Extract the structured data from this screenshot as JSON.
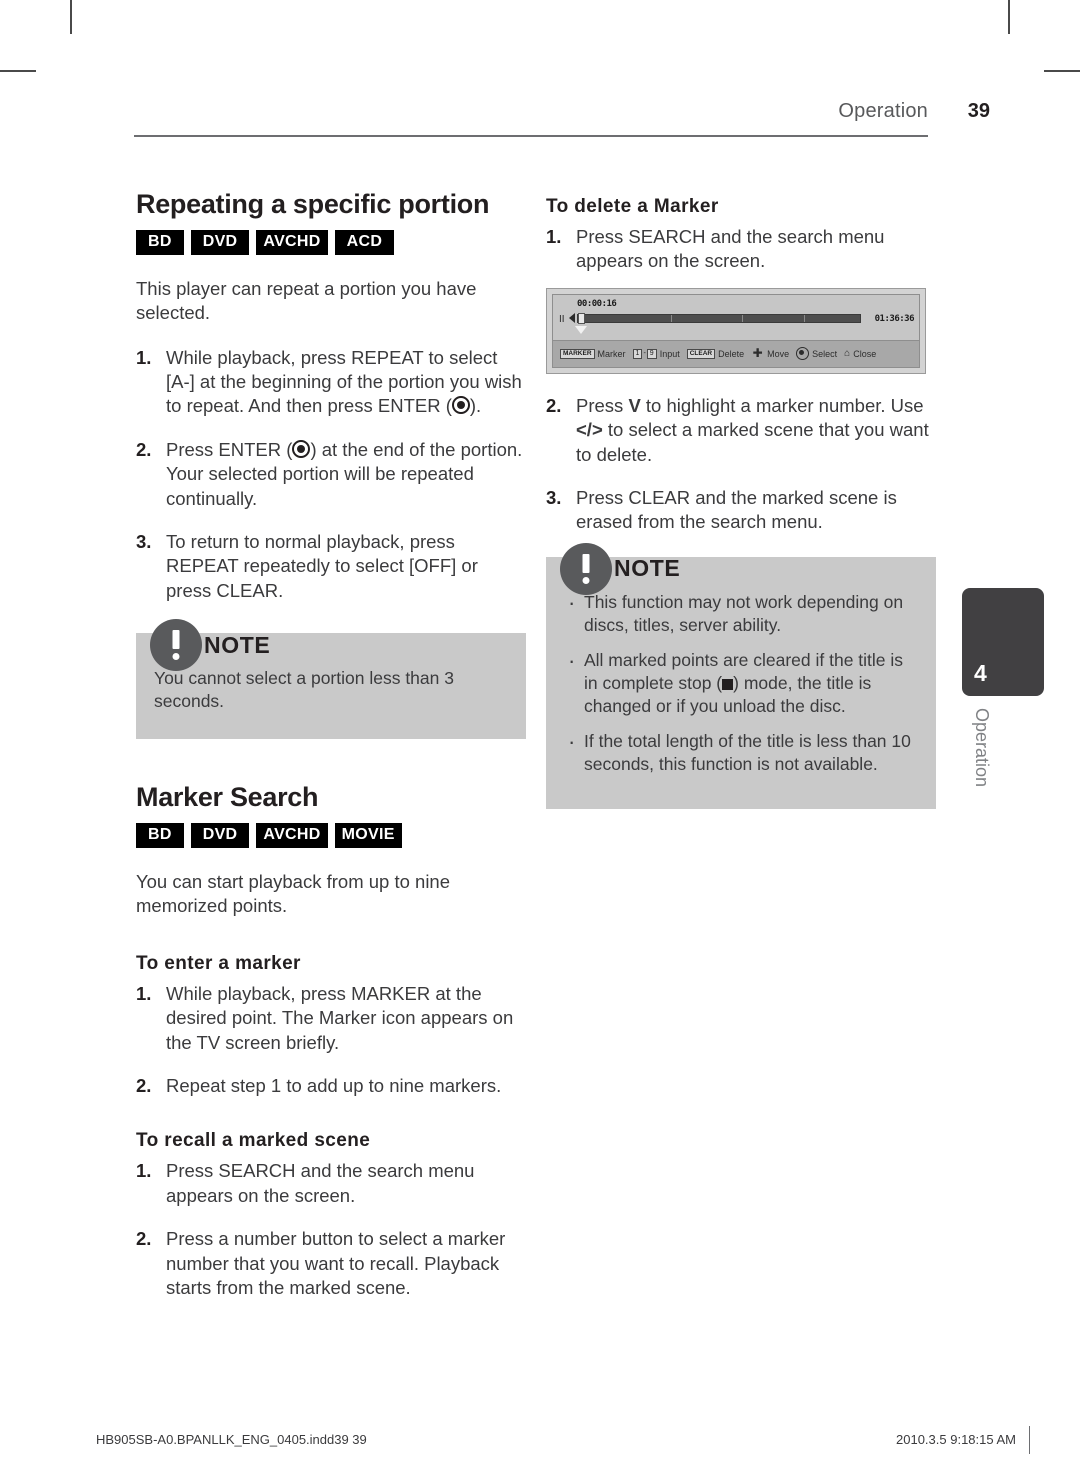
{
  "header": {
    "title": "Operation",
    "page_number": "39"
  },
  "left_column": {
    "section_title": "Repeating a specific portion",
    "badges": [
      "BD",
      "DVD",
      "AVCHD",
      "ACD"
    ],
    "intro": "This player can repeat a portion you have selected.",
    "steps": [
      {
        "num": "1.",
        "parts": [
          "While playback, press REPEAT to select [A-] at the beginning of the portion you wish to repeat. And then press ENTER (",
          ")."
        ]
      },
      {
        "num": "2.",
        "parts": [
          "Press ENTER (",
          ") at the end of the portion. Your selected portion will be repeated continually."
        ]
      },
      {
        "num": "3.",
        "parts": [
          "To return to normal playback, press REPEAT repeatedly to select [OFF] or press CLEAR.",
          ""
        ]
      }
    ],
    "note": {
      "label": "NOTE",
      "text": "You cannot select a portion less than 3 seconds."
    },
    "section2_title": "Marker Search",
    "badges2": [
      "BD",
      "DVD",
      "AVCHD",
      "MOVIE"
    ],
    "intro2": "You can start playback from up to nine memorized points.",
    "sub1_title": "To enter a marker",
    "sub1_steps": [
      {
        "num": "1.",
        "text": "While playback, press MARKER at the desired point. The Marker icon appears on the TV screen briefly."
      },
      {
        "num": "2.",
        "text": "Repeat step 1 to add up to nine markers."
      }
    ],
    "sub2_title": "To recall a marked scene",
    "sub2_steps": [
      {
        "num": "1.",
        "text": "Press SEARCH and the search menu appears on the screen."
      },
      {
        "num": "2.",
        "text": "Press a number button to select a marker number that you want to recall. Playback starts from the marked scene."
      }
    ]
  },
  "right_column": {
    "sub_title": "To delete a Marker",
    "step1": {
      "num": "1.",
      "text": "Press SEARCH and the search menu appears on the screen."
    },
    "osd": {
      "time_elapsed": "00:00:16",
      "time_total": "01:36:36",
      "pause_glyph": "II",
      "toolbar": [
        {
          "key": "MARKER",
          "label": "Marker",
          "icon": "key-button-icon"
        },
        {
          "key": "1 - 9",
          "label": "Input",
          "icon": "number-keys-icon"
        },
        {
          "key": "CLEAR",
          "label": "Delete",
          "icon": "key-button-icon"
        },
        {
          "key": "",
          "label": "Move",
          "icon": "dpad-icon"
        },
        {
          "key": "",
          "label": "Select",
          "icon": "enter-icon"
        },
        {
          "key": "",
          "label": "Close",
          "icon": "home-icon"
        }
      ]
    },
    "step2": {
      "num": "2.",
      "part1": "Press ",
      "key1": "V",
      "part2": " to highlight a marker number. Use ",
      "key2": "</>",
      "part3": " to select a marked scene that you want to delete."
    },
    "step3": {
      "num": "3.",
      "text": "Press CLEAR and the marked scene is erased from the search menu."
    },
    "note": {
      "label": "NOTE",
      "items": [
        {
          "text": "This function may not work depending on discs, titles, server ability."
        },
        {
          "pre": "All marked points are cleared if the title is in complete stop (",
          "post": ") mode, the title is changed or if you unload the disc."
        },
        {
          "text": "If the total length of the title is less than 10 seconds, this function is not available."
        }
      ]
    }
  },
  "thumb_tab": {
    "number": "4",
    "label": "Operation"
  },
  "footer": {
    "left": "HB905SB-A0.BPANLLK_ENG_0405.indd39   39",
    "right": "2010.3.5   9:18:15 AM"
  }
}
